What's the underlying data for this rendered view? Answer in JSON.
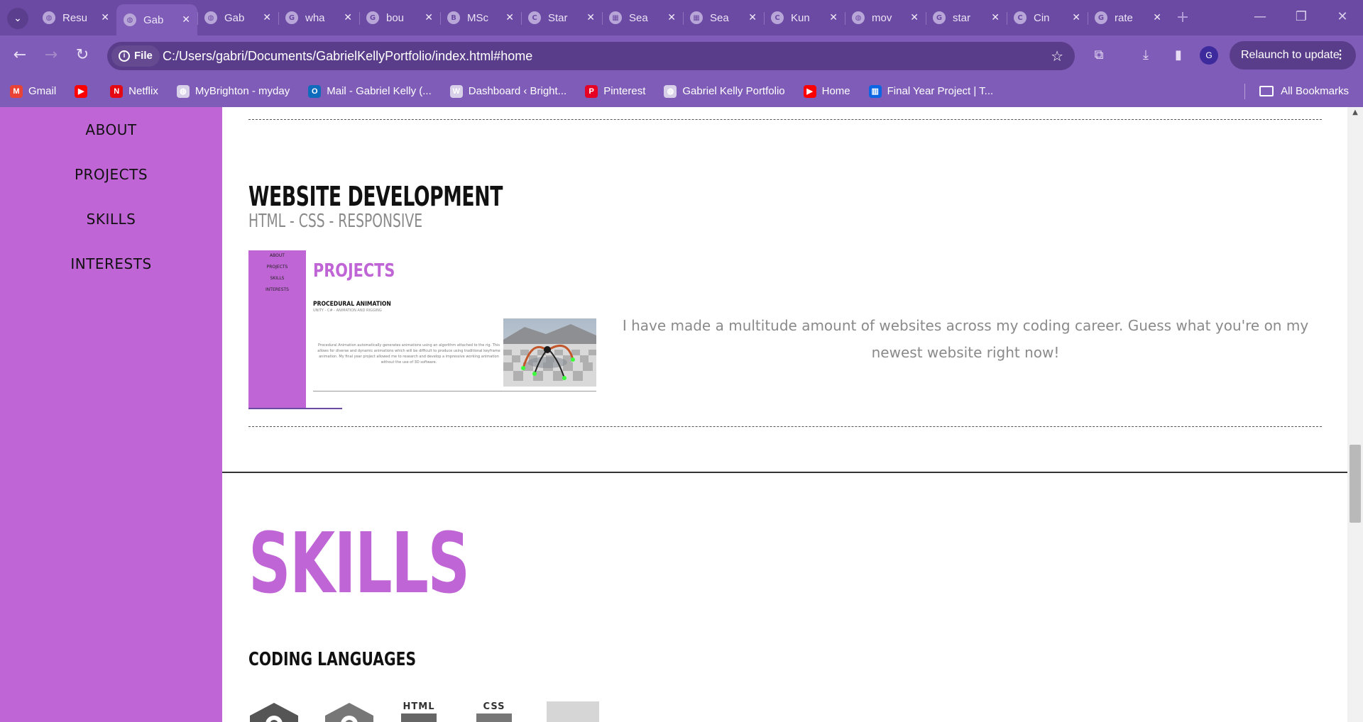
{
  "browser": {
    "tabs": [
      {
        "title": "Resu",
        "favicon": "globe-icon"
      },
      {
        "title": "Gab",
        "favicon": "globe-icon",
        "active": true
      },
      {
        "title": "Gab",
        "favicon": "globe-icon"
      },
      {
        "title": "wha",
        "favicon": "chrome-icon"
      },
      {
        "title": "bou",
        "favicon": "chrome-icon"
      },
      {
        "title": "MSc",
        "favicon": "b-logo-icon"
      },
      {
        "title": "Star",
        "favicon": "c-logo-icon"
      },
      {
        "title": "Sea",
        "favicon": "clapper-icon"
      },
      {
        "title": "Sea",
        "favicon": "clapper-icon"
      },
      {
        "title": "Kun",
        "favicon": "c-logo-icon"
      },
      {
        "title": "mov",
        "favicon": "globe-icon"
      },
      {
        "title": "star",
        "favicon": "google-icon"
      },
      {
        "title": "Cin",
        "favicon": "c-logo-icon"
      },
      {
        "title": "rate",
        "favicon": "google-icon"
      }
    ],
    "new_tab": "+",
    "site_chip": "File",
    "url": "C:/Users/gabri/Documents/GabrielKellyPortfolio/index.html#home",
    "profile_initial": "G",
    "relaunch_label": "Relaunch to update",
    "bookmarks": [
      {
        "label": "Gmail",
        "icon": "gmail-icon",
        "color": "#ea4335"
      },
      {
        "label": "",
        "icon": "youtube-icon",
        "color": "#ff0000"
      },
      {
        "label": "Netflix",
        "icon": "netflix-icon",
        "color": "#e50914"
      },
      {
        "label": "MyBrighton - myday",
        "icon": "globe-icon",
        "color": "#d8d0e8"
      },
      {
        "label": "Mail - Gabriel Kelly (...",
        "icon": "outlook-icon",
        "color": "#0f6cbd"
      },
      {
        "label": "Dashboard ‹ Bright...",
        "icon": "wordpress-icon",
        "color": "#d8d0e8"
      },
      {
        "label": "Pinterest",
        "icon": "pinterest-icon",
        "color": "#e60023"
      },
      {
        "label": "Gabriel Kelly Portfolio",
        "icon": "globe-icon",
        "color": "#d8d0e8"
      },
      {
        "label": "Home",
        "icon": "youtube-icon",
        "color": "#ff0000"
      },
      {
        "label": "Final Year Project | T...",
        "icon": "trello-icon",
        "color": "#0c66e4"
      }
    ],
    "all_bookmarks": "All Bookmarks"
  },
  "sidebar": {
    "items": [
      {
        "label": "ABOUT"
      },
      {
        "label": "PROJECTS"
      },
      {
        "label": "SKILLS"
      },
      {
        "label": "INTERESTS"
      }
    ]
  },
  "project": {
    "title": "WEBSITE DEVELOPMENT",
    "subtitle": "HTML - CSS - RESPONSIVE",
    "description": "I have made a multitude amount of websites across my coding career. Guess what you're on my newest website right now!",
    "thumbnail": {
      "nav": [
        "ABOUT",
        "PROJECTS",
        "SKILLS",
        "INTERESTS"
      ],
      "heading": "PROJECTS",
      "sub": "PROCEDURAL ANIMATION",
      "sub2": "UNITY - C# - ANIMATION AND RIGGING",
      "text": "Procedural Animation automatically generates animations using an algorithm attached to the rig. This allows for diverse and dynamic animations which will be difficult to produce using traditional keyframe animation. My final year project allowed me to research and develop a impressive working animation without the use of 3D software."
    }
  },
  "skills": {
    "title": "SKILLS",
    "coding_title": "CODING LANGUAGES",
    "icons": [
      {
        "name": "csharp-icon",
        "label": ""
      },
      {
        "name": "cplusplus-icon",
        "label": ""
      },
      {
        "name": "html-icon",
        "label": "HTML"
      },
      {
        "name": "css-icon",
        "label": "CSS"
      },
      {
        "name": "placeholder-icon",
        "label": ""
      }
    ]
  },
  "colors": {
    "sidebar": "#c065d6",
    "accent": "#c065d6",
    "chrome": "#6b4aa3"
  }
}
